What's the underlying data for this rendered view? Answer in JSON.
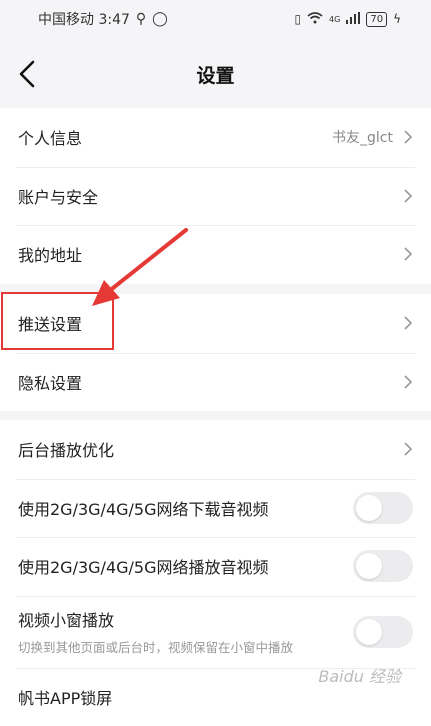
{
  "status_bar": {
    "carrier_time": "中国移动 3:47",
    "signal_label": "4G",
    "battery": "70"
  },
  "navbar": {
    "title": "设置"
  },
  "group1": {
    "items": [
      {
        "label": "个人信息",
        "value": "书友_glct"
      },
      {
        "label": "账户与安全"
      },
      {
        "label": "我的地址"
      }
    ]
  },
  "group2": {
    "items": [
      {
        "label": "推送设置"
      },
      {
        "label": "隐私设置"
      }
    ]
  },
  "group3": {
    "items": [
      {
        "label": "后台播放优化"
      },
      {
        "label": "使用2G/3G/4G/5G网络下载音视频",
        "toggle": false
      },
      {
        "label": "使用2G/3G/4G/5G网络播放音视频",
        "toggle": false
      },
      {
        "label": "视频小窗播放",
        "sub": "切换到其他页面或后台时，视频保留在小窗中播放",
        "toggle": false
      },
      {
        "label": "帆书APP锁屏"
      }
    ]
  },
  "watermark": "Baidu 经验",
  "colors": {
    "highlight": "#e53935",
    "toggle_off": "#ececee"
  }
}
